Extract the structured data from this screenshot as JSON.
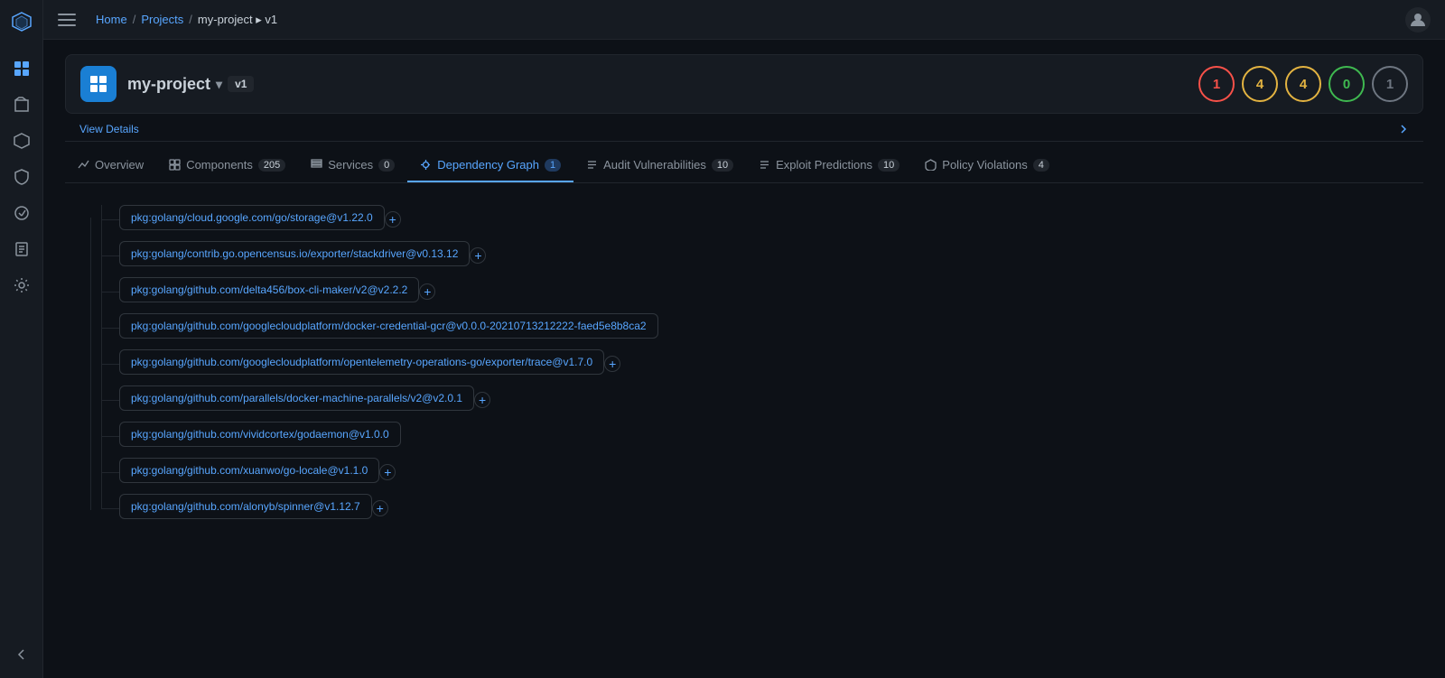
{
  "app": {
    "logo": "⬡",
    "hamburger_label": "Toggle menu"
  },
  "breadcrumb": {
    "items": [
      {
        "label": "Home",
        "href": "#"
      },
      {
        "label": "Projects",
        "href": "#"
      },
      {
        "label": "my-project ▸ v1",
        "href": null
      }
    ]
  },
  "sidebar": {
    "items": [
      {
        "name": "dashboard",
        "icon": "⊞",
        "label": "Dashboard"
      },
      {
        "name": "projects",
        "icon": "◈",
        "label": "Projects"
      },
      {
        "name": "components",
        "icon": "⬡",
        "label": "Components"
      },
      {
        "name": "shield",
        "icon": "⛊",
        "label": "Security"
      },
      {
        "name": "compliance",
        "icon": "⚖",
        "label": "Compliance"
      },
      {
        "name": "reports",
        "icon": "▤",
        "label": "Reports"
      },
      {
        "name": "settings",
        "icon": "✦",
        "label": "Settings"
      }
    ]
  },
  "project": {
    "icon": "⊞",
    "name": "my-project",
    "version": "v1",
    "dropdown_label": "▾",
    "view_details_label": "View Details"
  },
  "severity_badges": [
    {
      "level": "critical",
      "count": "1",
      "color_class": "critical"
    },
    {
      "level": "high",
      "count": "4",
      "color_class": "high"
    },
    {
      "level": "medium",
      "count": "4",
      "color_class": "medium"
    },
    {
      "level": "low",
      "count": "0",
      "color_class": "low"
    },
    {
      "level": "info",
      "count": "1",
      "color_class": "info"
    }
  ],
  "tabs": [
    {
      "name": "overview",
      "label": "Overview",
      "icon": "📈",
      "count": null,
      "active": false
    },
    {
      "name": "components",
      "label": "Components",
      "icon": "⊞",
      "count": "205",
      "active": false
    },
    {
      "name": "services",
      "label": "Services",
      "icon": "⊟",
      "count": "0",
      "active": false
    },
    {
      "name": "dependency-graph",
      "label": "Dependency Graph",
      "icon": "⊕",
      "count": "1",
      "active": true
    },
    {
      "name": "audit-vulnerabilities",
      "label": "Audit Vulnerabilities",
      "icon": "☰",
      "count": "10",
      "active": false
    },
    {
      "name": "exploit-predictions",
      "label": "Exploit Predictions",
      "icon": "☰",
      "count": "10",
      "active": false
    },
    {
      "name": "policy-violations",
      "label": "Policy Violations",
      "icon": "⬆",
      "count": "4",
      "active": false
    }
  ],
  "dependency_graph": {
    "nodes": [
      {
        "id": "node1",
        "label": "pkg:golang/cloud.google.com/go/storage@v1.22.0",
        "has_expand": true
      },
      {
        "id": "node2",
        "label": "pkg:golang/contrib.go.opencensus.io/exporter/stackdriver@v0.13.12",
        "has_expand": true
      },
      {
        "id": "node3",
        "label": "pkg:golang/github.com/delta456/box-cli-maker/v2@v2.2.2",
        "has_expand": true
      },
      {
        "id": "node4",
        "label": "pkg:golang/github.com/googlecloudplatform/docker-credential-gcr@v0.0.0-20210713212222-faed5e8b8ca2",
        "has_expand": false
      },
      {
        "id": "node5",
        "label": "pkg:golang/github.com/googlecloudplatform/opentelemetry-operations-go/exporter/trace@v1.7.0",
        "has_expand": true
      },
      {
        "id": "node6",
        "label": "pkg:golang/github.com/parallels/docker-machine-parallels/v2@v2.0.1",
        "has_expand": true
      },
      {
        "id": "node7",
        "label": "pkg:golang/github.com/vividcortex/godaemon@v1.0.0",
        "has_expand": false
      },
      {
        "id": "node8",
        "label": "pkg:golang/github.com/xuanwo/go-locale@v1.1.0",
        "has_expand": true
      },
      {
        "id": "node9",
        "label": "pkg:golang/github.com/alonyb/spinner@v1.12.7",
        "has_expand": true
      }
    ]
  }
}
